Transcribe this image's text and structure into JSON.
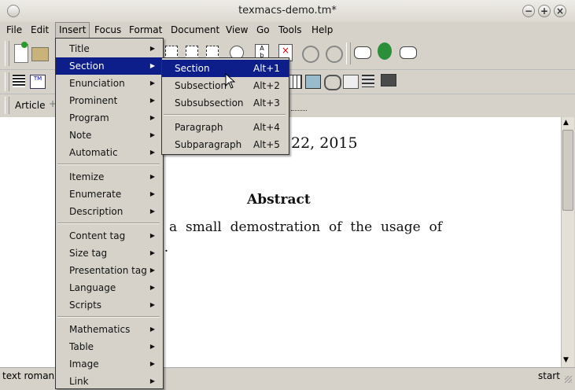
{
  "window": {
    "title": "texmacs-demo.tm*"
  },
  "menubar": {
    "items": [
      "File",
      "Edit",
      "Insert",
      "Focus",
      "Format",
      "Document",
      "View",
      "Go",
      "Tools",
      "Help"
    ],
    "active": "Insert"
  },
  "format_bar": {
    "style_label": "Article"
  },
  "document": {
    "date_text": "22, 2015",
    "abstract_heading": "Abstract",
    "abstract_line1": "a  small  demostration  of  the  usage  of",
    "abstract_line2": "s."
  },
  "statusbar": {
    "left": "text roman 1",
    "right": "start"
  },
  "insert_menu": {
    "items": [
      {
        "label": "Title",
        "submenu": true
      },
      {
        "label": "Section",
        "submenu": true,
        "selected": true
      },
      {
        "label": "Enunciation",
        "submenu": true
      },
      {
        "label": "Prominent",
        "submenu": true
      },
      {
        "label": "Program",
        "submenu": true
      },
      {
        "label": "Note",
        "submenu": true
      },
      {
        "label": "Automatic",
        "submenu": true
      },
      {
        "label": "Itemize",
        "submenu": true
      },
      {
        "label": "Enumerate",
        "submenu": true
      },
      {
        "label": "Description",
        "submenu": true
      },
      {
        "label": "Content tag",
        "submenu": true
      },
      {
        "label": "Size tag",
        "submenu": true
      },
      {
        "label": "Presentation tag",
        "submenu": true
      },
      {
        "label": "Language",
        "submenu": true
      },
      {
        "label": "Scripts",
        "submenu": true
      },
      {
        "label": "Mathematics",
        "submenu": true
      },
      {
        "label": "Table",
        "submenu": true
      },
      {
        "label": "Image",
        "submenu": true
      },
      {
        "label": "Link",
        "submenu": true
      }
    ]
  },
  "section_submenu": {
    "items": [
      {
        "label": "Section",
        "shortcut": "Alt+1",
        "selected": true
      },
      {
        "label": "Subsection",
        "shortcut": "Alt+2"
      },
      {
        "label": "Subsubsection",
        "shortcut": "Alt+3"
      },
      {
        "label": "Paragraph",
        "shortcut": "Alt+4"
      },
      {
        "label": "Subparagraph",
        "shortcut": "Alt+5"
      }
    ]
  },
  "colors": {
    "selection": "#0d1e8a",
    "menu_bg": "#d6d2ca",
    "doc_bg": "#ffffff"
  }
}
